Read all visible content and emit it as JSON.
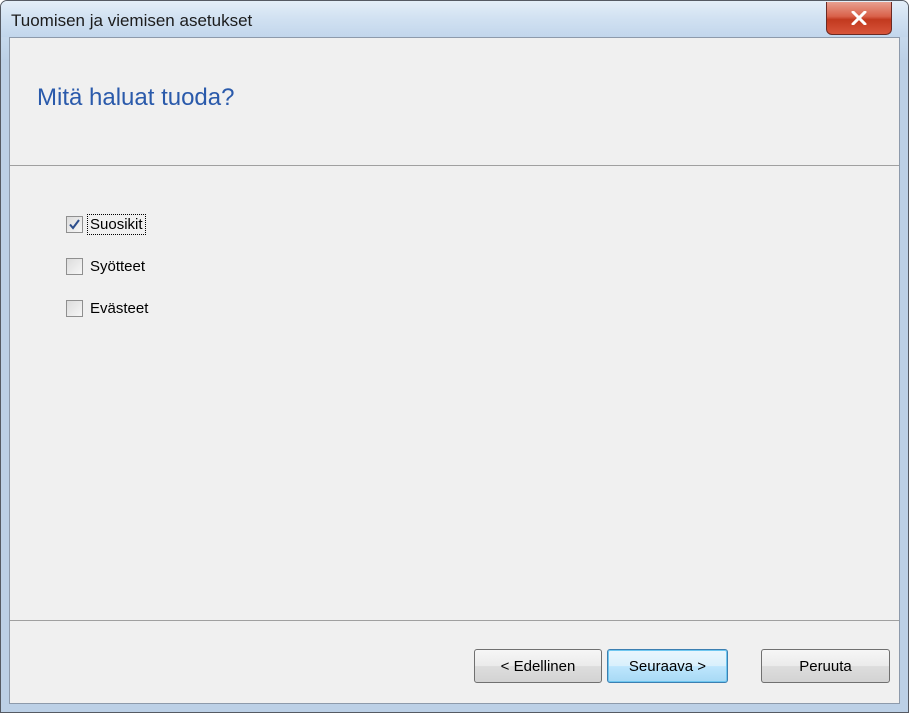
{
  "window": {
    "title": "Tuomisen ja viemisen asetukset"
  },
  "header": {
    "title": "Mitä haluat tuoda?"
  },
  "options": [
    {
      "label": "Suosikit",
      "checked": true,
      "focused": true
    },
    {
      "label": "Syötteet",
      "checked": false,
      "focused": false
    },
    {
      "label": "Evästeet",
      "checked": false,
      "focused": false
    }
  ],
  "buttons": {
    "back_label": "< Edellinen",
    "next_label": "Seuraava >",
    "cancel_label": "Peruuta"
  },
  "icons": {
    "close": "close-icon",
    "checkmark": "check-icon"
  },
  "colors": {
    "header_title": "#2a5aab",
    "close_button": "#c2391f",
    "default_button_border": "#3c7fb1"
  }
}
